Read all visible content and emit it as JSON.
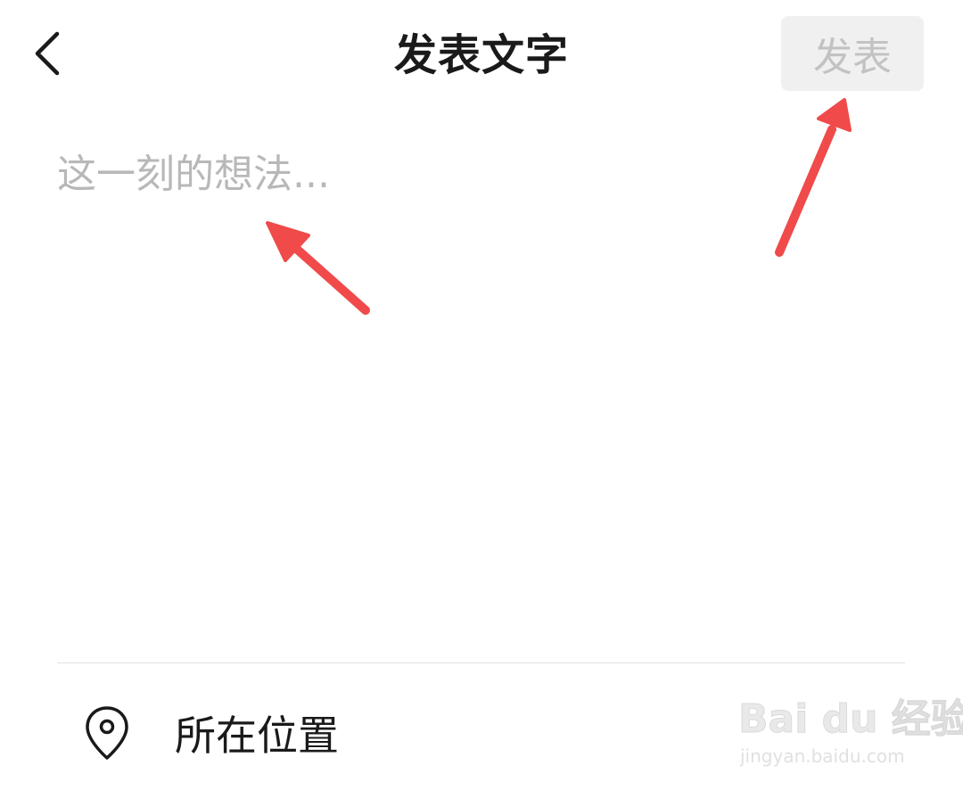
{
  "header": {
    "title": "发表文字",
    "publish_label": "发表",
    "back_icon": "chevron-left-icon"
  },
  "compose": {
    "placeholder": "这一刻的想法...",
    "value": ""
  },
  "location": {
    "label": "所在位置",
    "icon": "location-pin-icon"
  },
  "annotations": {
    "arrow_color": "#f04a4a"
  },
  "watermark": {
    "logo": "Bai du 经验",
    "url": "jingyan.baidu.com"
  },
  "colors": {
    "publish_disabled_bg": "#f0f0f0",
    "publish_disabled_text": "#c2c2c2",
    "placeholder_text": "#b8b8b8",
    "divider": "#e2e2e2"
  }
}
